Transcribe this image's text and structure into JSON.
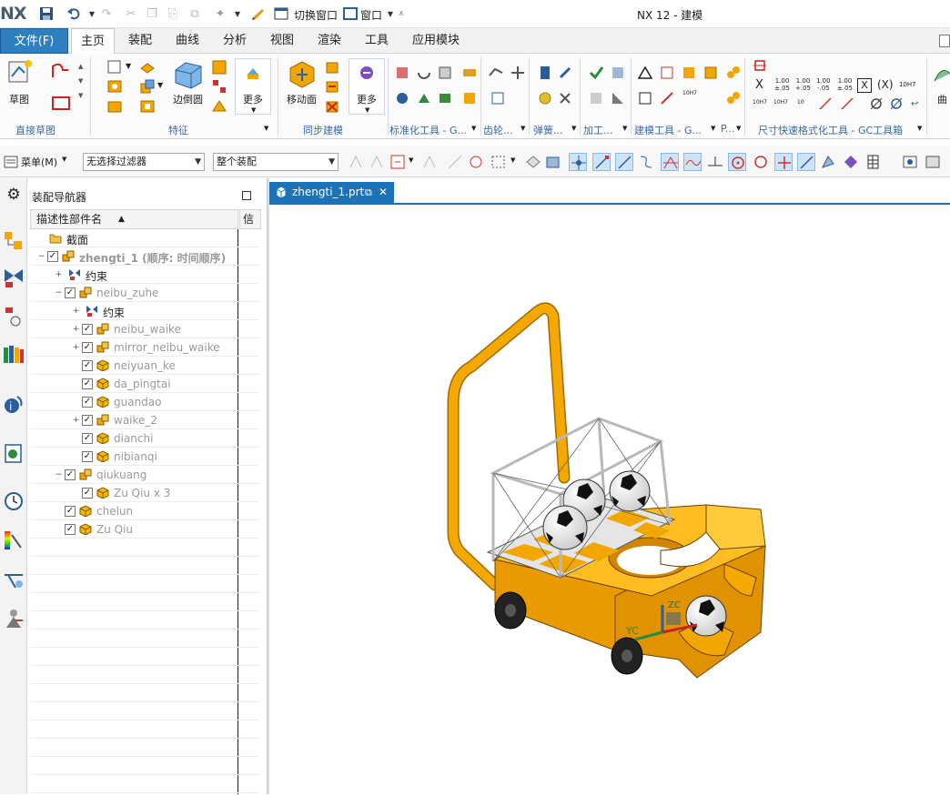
{
  "app": {
    "logo": "NX",
    "title": "NX 12 - 建模"
  },
  "quick_access": {
    "switch_window": "切换窗口",
    "window": "窗口"
  },
  "menubar": {
    "items": [
      "文件(F)",
      "主页",
      "装配",
      "曲线",
      "分析",
      "视图",
      "渲染",
      "工具",
      "应用模块"
    ],
    "active": "主页"
  },
  "ribbon": {
    "buttons": {
      "sketch": "草图",
      "edge_blend": "边倒圆",
      "more1": "更多",
      "move_face": "移动面",
      "more2": "更多"
    },
    "groups": [
      "直接草图",
      "特征",
      "同步建模",
      "标准化工具 - G...",
      "齿轮...",
      "弹簧...",
      "加工...",
      "建模工具 - G...",
      "P...",
      "尺寸快速格式化工具 - GC工具箱"
    ],
    "gdt": {
      "v1a": "1.00",
      "v1b": "±.05",
      "v2a": "1.00",
      "v2b": "+.05",
      "v3a": "1.00",
      "v3b": "-.05",
      "v4a": "1.00",
      "v4b": "±.05",
      "x": "X",
      "xp": "(X)",
      "tol1": "10H7",
      "tol2": "10H7",
      "tol3": "10H7",
      "tol4": "10",
      "tol5": "10H7"
    }
  },
  "toolbar": {
    "menu": "菜单(M)",
    "filter": "无选择过滤器",
    "scope": "整个装配"
  },
  "navigator": {
    "title": "装配导航器",
    "col_name": "描述性部件名",
    "col_info": "信",
    "rows": [
      {
        "label": "截面",
        "style": "normal"
      },
      {
        "label": "zhengti_1 (顺序: 时间顺序)",
        "style": "bold"
      },
      {
        "label": "约束",
        "style": "normal"
      },
      {
        "label": "neibu_zuhe",
        "style": "dim"
      },
      {
        "label": "约束",
        "style": "normal"
      },
      {
        "label": "neibu_waike",
        "style": "dim"
      },
      {
        "label": "mirror_neibu_waike",
        "style": "dim"
      },
      {
        "label": "neiyuan_ke",
        "style": "dim"
      },
      {
        "label": "da_pingtai",
        "style": "dim"
      },
      {
        "label": "guandao",
        "style": "dim"
      },
      {
        "label": "waike_2",
        "style": "dim"
      },
      {
        "label": "dianchi",
        "style": "dim"
      },
      {
        "label": "nibianqi",
        "style": "dim"
      },
      {
        "label": "qiukuang",
        "style": "dim"
      },
      {
        "label": "Zu Qiu x 3",
        "style": "dim"
      },
      {
        "label": "chelun",
        "style": "dim"
      },
      {
        "label": "Zu Qiu",
        "style": "dim"
      }
    ]
  },
  "viewport": {
    "tab": "zhengti_1.prt",
    "axis_y": "YC",
    "axis_z": "ZC"
  },
  "colors": {
    "accent": "#2f7ec0",
    "model_orange": "#f2a700",
    "tab_blue": "#1d72b8"
  }
}
